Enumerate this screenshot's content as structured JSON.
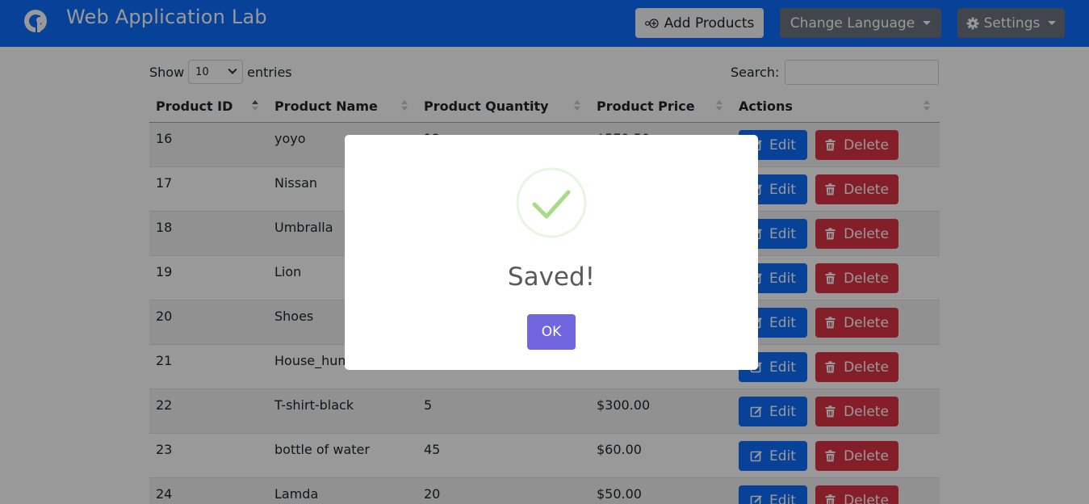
{
  "header": {
    "title": "Web Application Lab",
    "logo_icon": "app-logo-icon",
    "add_products_label": "Add Products",
    "change_language_label": "Change Language",
    "settings_label": "Settings"
  },
  "table_controls": {
    "show_label": "Show",
    "page_length": "10",
    "entries_label": "entries",
    "search_label": "Search:",
    "search_value": ""
  },
  "table": {
    "columns": [
      "Product ID",
      "Product Name",
      "Product Quantity",
      "Product Price",
      "Actions"
    ],
    "edit_label": "Edit",
    "delete_label": "Delete",
    "rows": [
      {
        "id": "16",
        "name": "yoyo",
        "quantity": "12",
        "price": "$579.50"
      },
      {
        "id": "17",
        "name": "Nissan",
        "quantity": "",
        "price": ""
      },
      {
        "id": "18",
        "name": "Umbralla",
        "quantity": "",
        "price": ""
      },
      {
        "id": "19",
        "name": "Lion",
        "quantity": "",
        "price": ""
      },
      {
        "id": "20",
        "name": "Shoes",
        "quantity": "",
        "price": ""
      },
      {
        "id": "21",
        "name": "House_hum",
        "quantity": "",
        "price": ""
      },
      {
        "id": "22",
        "name": "T-shirt-black",
        "quantity": "5",
        "price": "$300.00"
      },
      {
        "id": "23",
        "name": "bottle of water",
        "quantity": "45",
        "price": "$60.00"
      },
      {
        "id": "24",
        "name": "Lamda",
        "quantity": "20",
        "price": "$50.00"
      }
    ]
  },
  "modal": {
    "title": "Saved!",
    "ok_label": "OK",
    "icon": "success-check-icon"
  },
  "colors": {
    "navbar": "#0d6efd",
    "edit": "#0d6efd",
    "delete": "#dc3545",
    "confirm": "#7066e0",
    "success": "#a5dc86"
  }
}
